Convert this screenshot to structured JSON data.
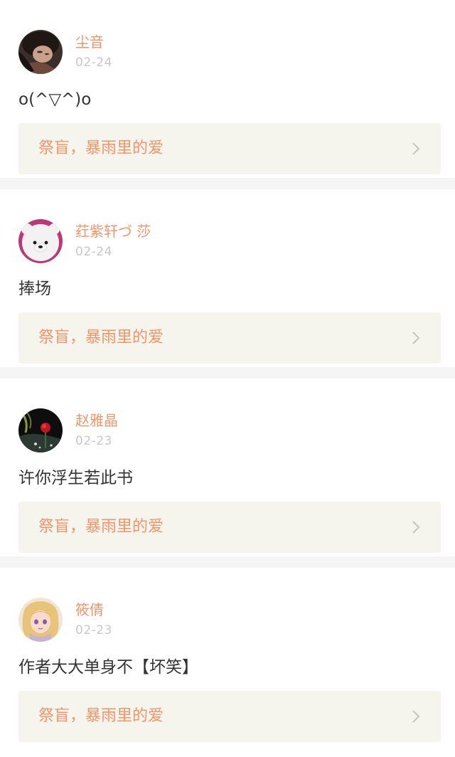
{
  "feed": {
    "items": [
      {
        "username": "尘音",
        "date": "02-24",
        "comment": "o(^▽^)o",
        "book_title": "祭盲，暴雨里的爱",
        "avatar_icon": "portrait-girl-icon"
      },
      {
        "username": "荭紫轩づ 莎",
        "date": "02-24",
        "comment": "捧场",
        "book_title": "祭盲，暴雨里的爱",
        "avatar_icon": "white-bear-icon"
      },
      {
        "username": "赵雅晶",
        "date": "02-23",
        "comment": "许你浮生若此书",
        "book_title": "祭盲，暴雨里的爱",
        "avatar_icon": "red-rose-icon"
      },
      {
        "username": "筱倩",
        "date": "02-23",
        "comment": "作者大大单身不【坏笑】",
        "book_title": "祭盲，暴雨里的爱",
        "avatar_icon": "anime-girl-icon"
      }
    ]
  },
  "colors": {
    "username": "#f0956a",
    "date": "#c8c8c8",
    "comment": "#333333",
    "book_link_bg": "#f5f5ee",
    "tab_indicator": "#ef6aa0",
    "separator": "#f5f5f5"
  }
}
